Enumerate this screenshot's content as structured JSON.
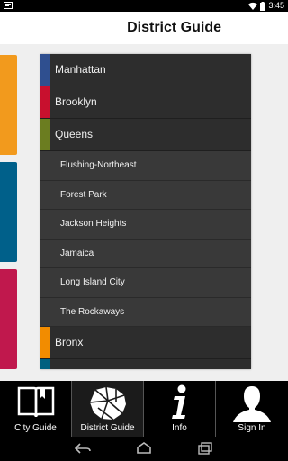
{
  "status_bar": {
    "time": "3:45"
  },
  "header": {
    "title": "District Guide"
  },
  "side_cards": [
    {
      "color": "#f29a1d"
    },
    {
      "color": "#00608a"
    },
    {
      "color": "#c0184d"
    }
  ],
  "list": {
    "rows": [
      {
        "label": "Manhattan",
        "color": "#2f4f8f",
        "type": "district"
      },
      {
        "label": "Brooklyn",
        "color": "#c8102e",
        "type": "district"
      },
      {
        "label": "Queens",
        "color": "#6b7d20",
        "type": "district"
      },
      {
        "label": "Flushing-Northeast",
        "type": "sub"
      },
      {
        "label": "Forest Park",
        "type": "sub"
      },
      {
        "label": "Jackson Heights",
        "type": "sub"
      },
      {
        "label": "Jamaica",
        "type": "sub"
      },
      {
        "label": "Long Island City",
        "type": "sub"
      },
      {
        "label": "The Rockaways",
        "type": "sub"
      },
      {
        "label": "Bronx",
        "color": "#f28c00",
        "type": "district"
      },
      {
        "label": "",
        "color": "#00607f",
        "type": "district"
      }
    ]
  },
  "tabs": [
    {
      "label": "City Guide",
      "icon": "book-icon",
      "active": false
    },
    {
      "label": "District Guide",
      "icon": "district-map-icon",
      "active": true
    },
    {
      "label": "Info",
      "icon": "info-icon",
      "active": false
    },
    {
      "label": "Sign In",
      "icon": "user-silhouette-icon",
      "active": false
    }
  ]
}
